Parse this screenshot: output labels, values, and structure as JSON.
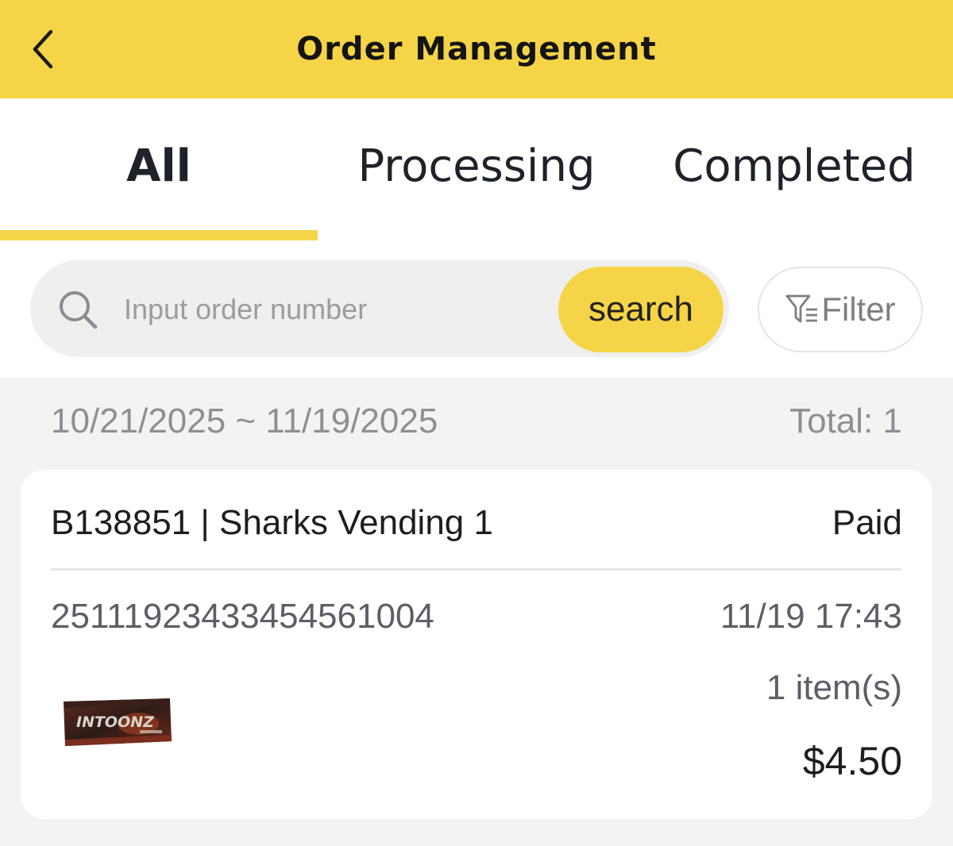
{
  "header": {
    "title": "Order Management",
    "background_color": "#f5d547",
    "back_icon": "chevron-left-icon"
  },
  "tabs": [
    {
      "label": "All",
      "active": true
    },
    {
      "label": "Processing",
      "active": false
    },
    {
      "label": "Completed",
      "active": false
    }
  ],
  "search": {
    "placeholder": "Input order number",
    "value": "",
    "button_label": "search",
    "icon": "search-icon"
  },
  "filter": {
    "label": "Filter",
    "icon": "filter-icon"
  },
  "summary": {
    "date_range": "10/21/2025 ~ 11/19/2025",
    "total": "Total: 1"
  },
  "orders": [
    {
      "machine": "B138851 | Sharks Vending 1",
      "status": "Paid",
      "order_number": "2511192343345456100​4",
      "time": "11/19 17:43",
      "item_count": "1 item(s)",
      "price": "$4.50",
      "product_image": "chocolate-bar-thumbnail",
      "product_text": "INTOONZ"
    }
  ],
  "colors": {
    "accent": "#f5d547",
    "muted_text": "#8d8f93",
    "secondary_text": "#5c5f66",
    "page_background": "#f3f3f3"
  }
}
